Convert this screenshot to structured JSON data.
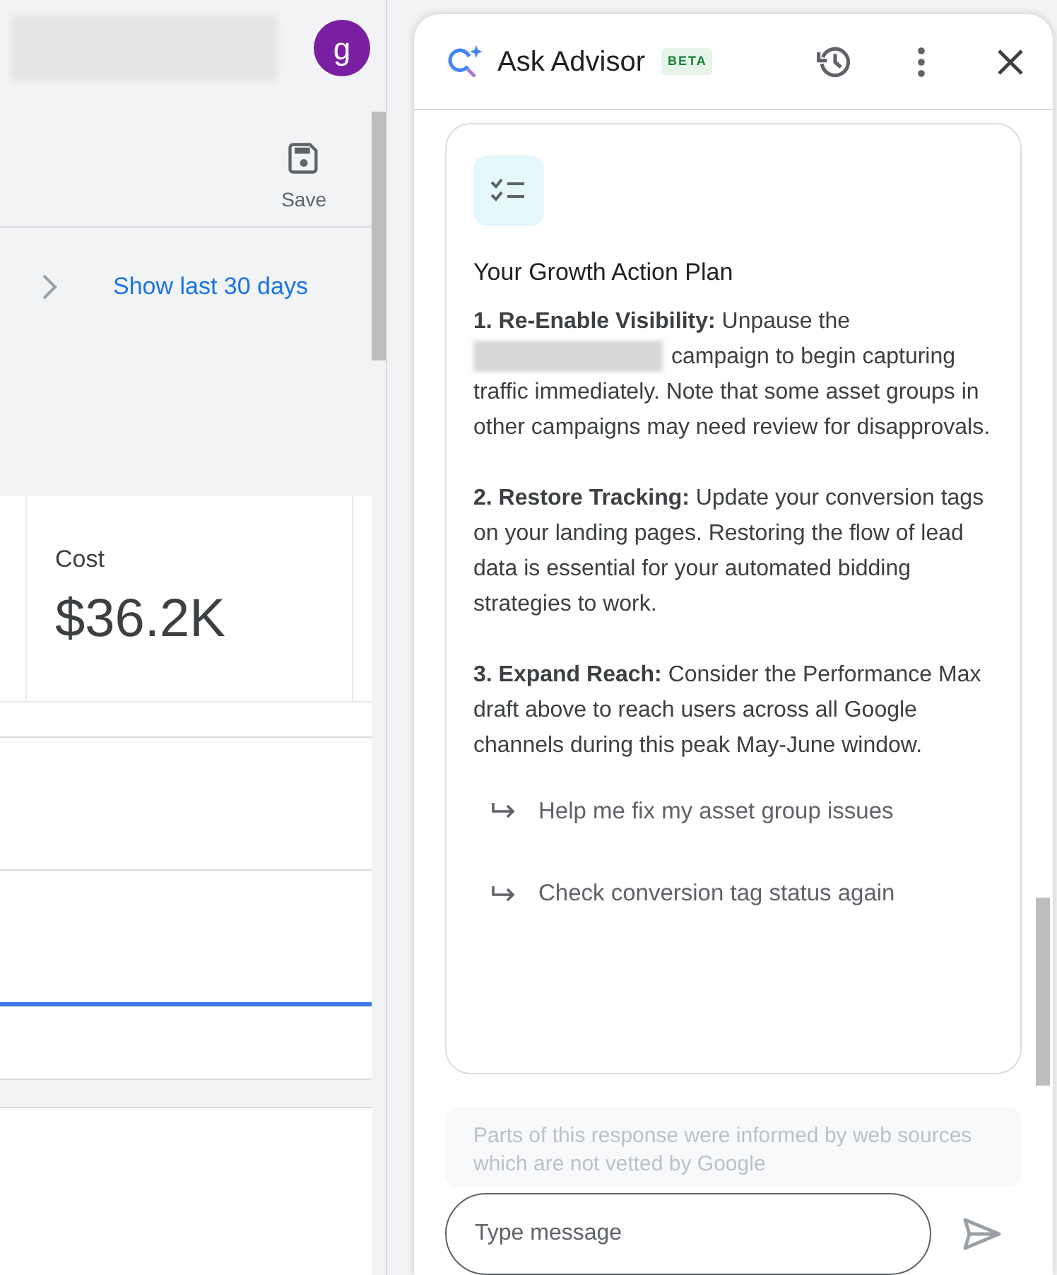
{
  "account_header": {
    "account_name_redacted": true,
    "avatar_letter": "g"
  },
  "toolbar": {
    "save_label": "Save"
  },
  "date_range": {
    "link": "Show last 30 days"
  },
  "metric_card": {
    "label": "Cost",
    "value": "$36.2K"
  },
  "advisor": {
    "title": "Ask Advisor",
    "badge": "BETA",
    "plan_title": "Your Growth Action Plan",
    "steps": [
      {
        "text": "**1. Re-Enable Visibility:** Unpause the",
        "redacted": true,
        "text_after": "campaign to begin capturing",
        "text_rest": "traffic immediately. Note that some asset groups in other campaigns may need review for disapprovals."
      },
      {
        "text": "**2. Restore Tracking:** Update your conversion tags on your landing pages. Restoring the flow of lead data is essential for your automated bidding strategies to work.",
        "redacted": false
      },
      {
        "text": "**3. Expand Reach:** Consider the Performance Max draft above to reach users across all Google channels during this peak May-June window.",
        "redacted": false
      }
    ],
    "suggestions": [
      "Help me fix my asset group issues",
      "Check conversion tag status again"
    ],
    "disclaimer": "Parts of this response were informed by web sources which are not vetted by Google",
    "message_field": {
      "placeholder": "Type message"
    }
  }
}
